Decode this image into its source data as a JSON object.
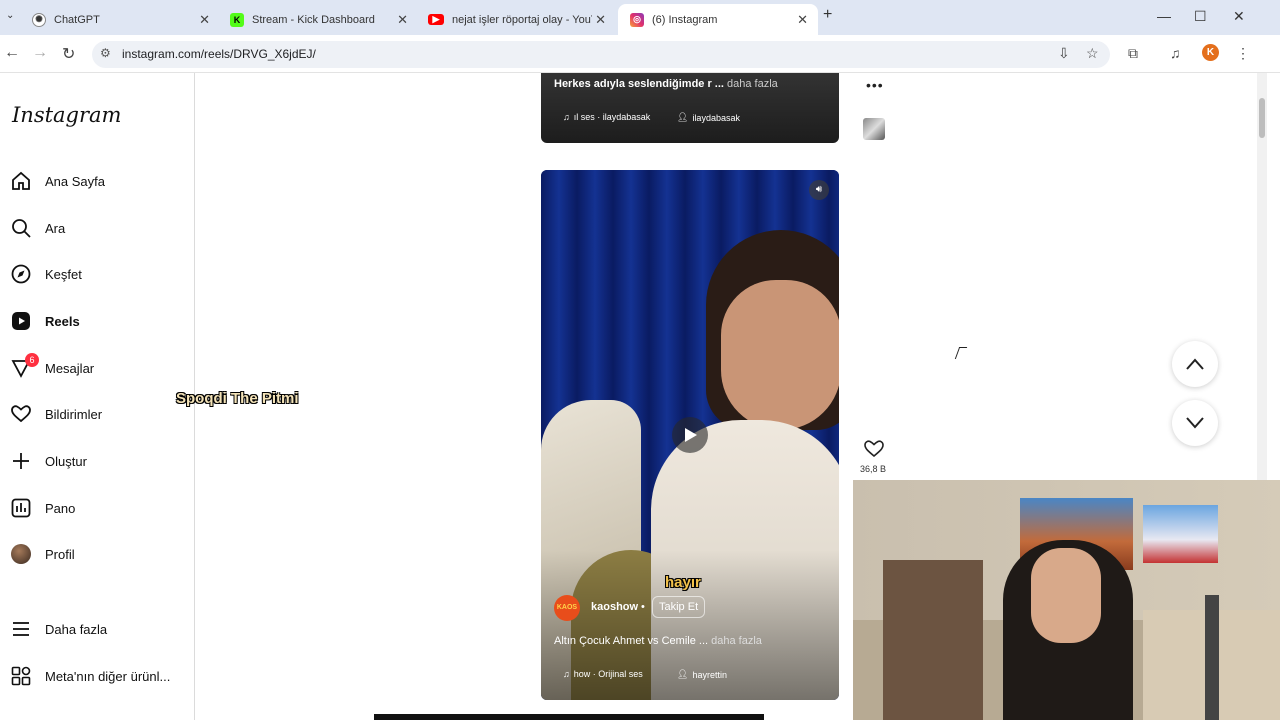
{
  "tabs": [
    {
      "title": "ChatGPT",
      "icon": "chatgpt-icon",
      "active": false
    },
    {
      "title": "Stream - Kick Dashboard",
      "icon": "kick-icon",
      "active": false
    },
    {
      "title": "nejat işler röportaj olay - YouTu",
      "icon": "youtube-icon",
      "active": false
    },
    {
      "title": "(6) Instagram",
      "icon": "instagram-icon",
      "active": true
    }
  ],
  "address": {
    "url": "instagram.com/reels/DRVG_X6jdEJ/",
    "profile_initial": "K"
  },
  "sidebar": {
    "logo": "Instagram",
    "items": [
      {
        "label": "Ana Sayfa",
        "icon": "home-icon"
      },
      {
        "label": "Ara",
        "icon": "search-icon"
      },
      {
        "label": "Keşfet",
        "icon": "compass-icon"
      },
      {
        "label": "Reels",
        "icon": "reels-icon"
      },
      {
        "label": "Mesajlar",
        "icon": "messenger-icon",
        "badge": "6"
      },
      {
        "label": "Bildirimler",
        "icon": "heart-icon"
      },
      {
        "label": "Oluştur",
        "icon": "plus-icon"
      },
      {
        "label": "Pano",
        "icon": "dashboard-icon"
      },
      {
        "label": "Profil",
        "icon": "profile-avatar"
      },
      {
        "label": "Daha fazla",
        "icon": "menu-icon"
      },
      {
        "label": "Meta'nın diğer ürünl...",
        "icon": "meta-apps-icon"
      }
    ]
  },
  "overlay_text": "Spoqdi  The Pitmi",
  "previous_reel": {
    "description": "Herkes adıyla seslendiğimde r ...",
    "more": "daha fazla",
    "audio": "ıl ses · ilaydabasak",
    "tagged": "ilaydabasak"
  },
  "current_reel": {
    "caption": "hayır",
    "account_badge": "KAOS",
    "username": "kaoshow",
    "separator": "•",
    "follow_label": "Takip Et",
    "description": "Altın Çocuk Ahmet vs Cemile ...",
    "more": "daha fazla",
    "audio": "how · Orijinal ses",
    "tagged": "hayrettin",
    "likes": "36,8 B"
  },
  "colors": {
    "badge": "#ff3040",
    "kick": "#53fc18",
    "youtube": "#ff0000"
  }
}
